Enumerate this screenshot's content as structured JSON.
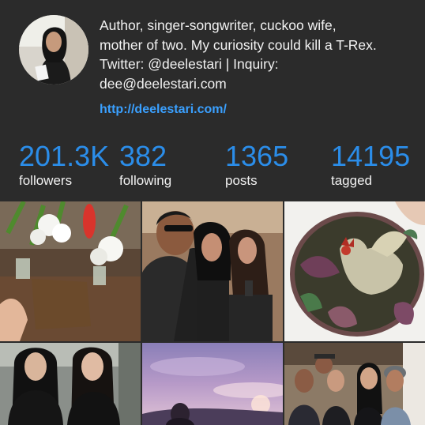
{
  "profile": {
    "bio_lines": [
      "Author, singer-songwriter, cuckoo wife,",
      "mother of two. My curiosity could kill a T-Rex.",
      "Twitter: @deelestari | Inquiry:",
      "dee@deelestari.com"
    ],
    "website": "http://deelestari.com/",
    "avatar_icon": "profile-photo"
  },
  "stats": [
    {
      "value": "201.3K",
      "label": "followers"
    },
    {
      "value": "382",
      "label": "following"
    },
    {
      "value": "1365",
      "label": "posts"
    },
    {
      "value": "14195",
      "label": "tagged"
    }
  ],
  "colors": {
    "background": "#2b2b2b",
    "accent": "#2b8de9",
    "link": "#3aa0ff",
    "text": "#f2f2f2"
  },
  "photos": [
    {
      "subject": "white-flowers-and-book"
    },
    {
      "subject": "man-singing-with-microphone"
    },
    {
      "subject": "rooster-drawing"
    },
    {
      "subject": "two-women-portrait"
    },
    {
      "subject": "purple-sunset-sky"
    },
    {
      "subject": "group-photo"
    }
  ]
}
